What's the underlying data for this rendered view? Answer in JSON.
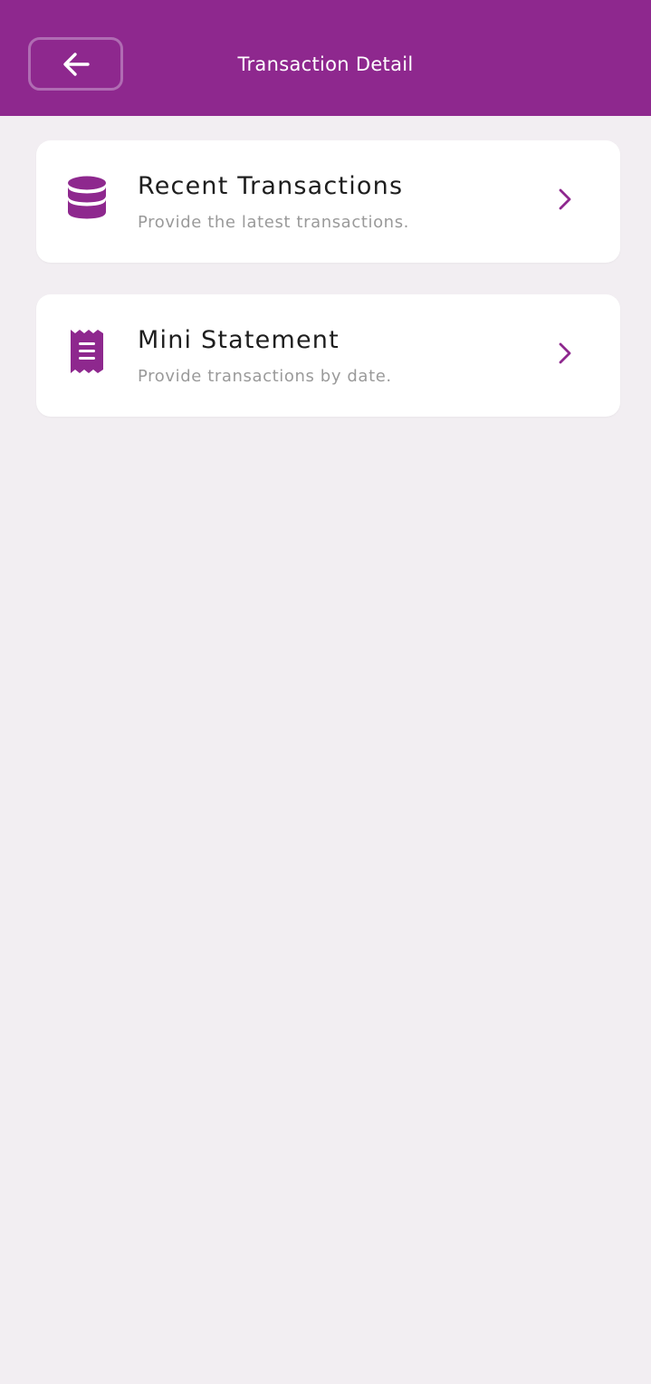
{
  "header": {
    "title": "Transaction Detail",
    "back_icon": "arrow-left-icon"
  },
  "menu": {
    "items": [
      {
        "label": "Recent Transactions",
        "description": "Provide the latest transactions.",
        "icon": "database-icon"
      },
      {
        "label": "Mini Statement",
        "description": "Provide transactions by date.",
        "icon": "receipt-icon"
      }
    ]
  },
  "colors": {
    "brand": "#8e288e",
    "background": "#f2eef2",
    "card": "#ffffff",
    "text_primary": "#1e1e1e",
    "text_secondary": "#9a9a9a"
  }
}
